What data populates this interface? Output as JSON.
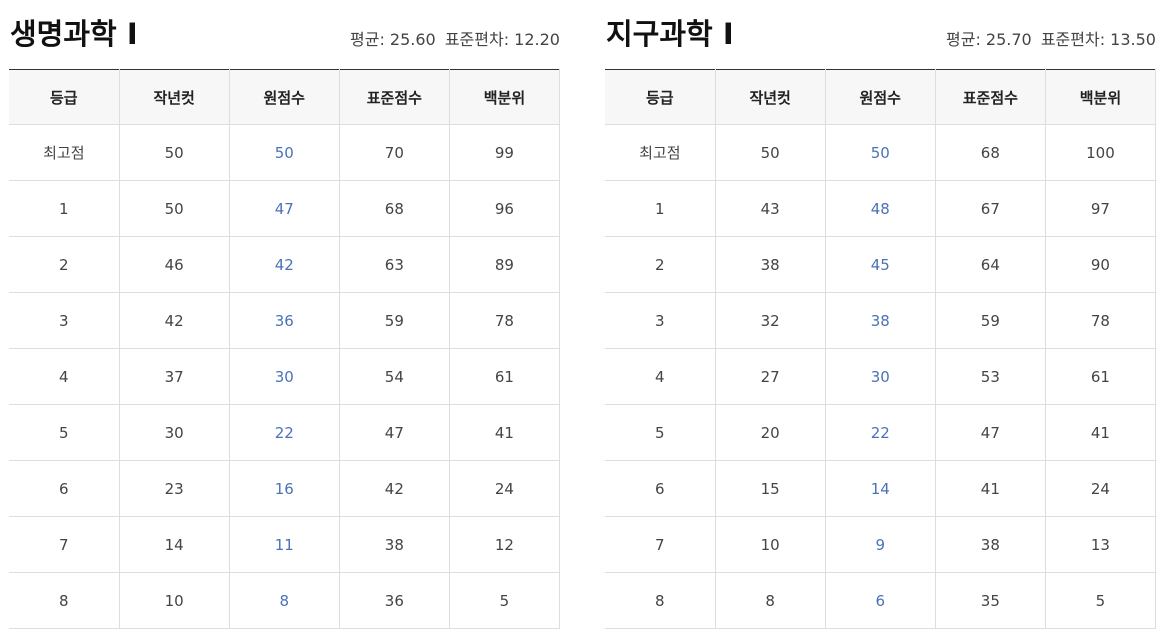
{
  "columns": [
    "등급",
    "작년컷",
    "원점수",
    "표준점수",
    "백분위"
  ],
  "panels": [
    {
      "title": "생명과학 Ⅰ",
      "mean_label": "평균: 25.60",
      "sd_label": "표준편차: 12.20",
      "rows": [
        [
          "최고점",
          "50",
          "50",
          "70",
          "99"
        ],
        [
          "1",
          "50",
          "47",
          "68",
          "96"
        ],
        [
          "2",
          "46",
          "42",
          "63",
          "89"
        ],
        [
          "3",
          "42",
          "36",
          "59",
          "78"
        ],
        [
          "4",
          "37",
          "30",
          "54",
          "61"
        ],
        [
          "5",
          "30",
          "22",
          "47",
          "41"
        ],
        [
          "6",
          "23",
          "16",
          "42",
          "24"
        ],
        [
          "7",
          "14",
          "11",
          "38",
          "12"
        ],
        [
          "8",
          "10",
          "8",
          "36",
          "5"
        ]
      ]
    },
    {
      "title": "지구과학 Ⅰ",
      "mean_label": "평균: 25.70",
      "sd_label": "표준편차: 13.50",
      "rows": [
        [
          "최고점",
          "50",
          "50",
          "68",
          "100"
        ],
        [
          "1",
          "43",
          "48",
          "67",
          "97"
        ],
        [
          "2",
          "38",
          "45",
          "64",
          "90"
        ],
        [
          "3",
          "32",
          "38",
          "59",
          "78"
        ],
        [
          "4",
          "27",
          "30",
          "53",
          "61"
        ],
        [
          "5",
          "20",
          "22",
          "47",
          "41"
        ],
        [
          "6",
          "15",
          "14",
          "41",
          "24"
        ],
        [
          "7",
          "10",
          "9",
          "38",
          "13"
        ],
        [
          "8",
          "8",
          "6",
          "35",
          "5"
        ]
      ]
    }
  ],
  "colors": {
    "raw_score_text": "#4a72b8",
    "header_bg": "#f7f7f7",
    "grid_line": "#dddddd",
    "top_rule": "#333333"
  }
}
